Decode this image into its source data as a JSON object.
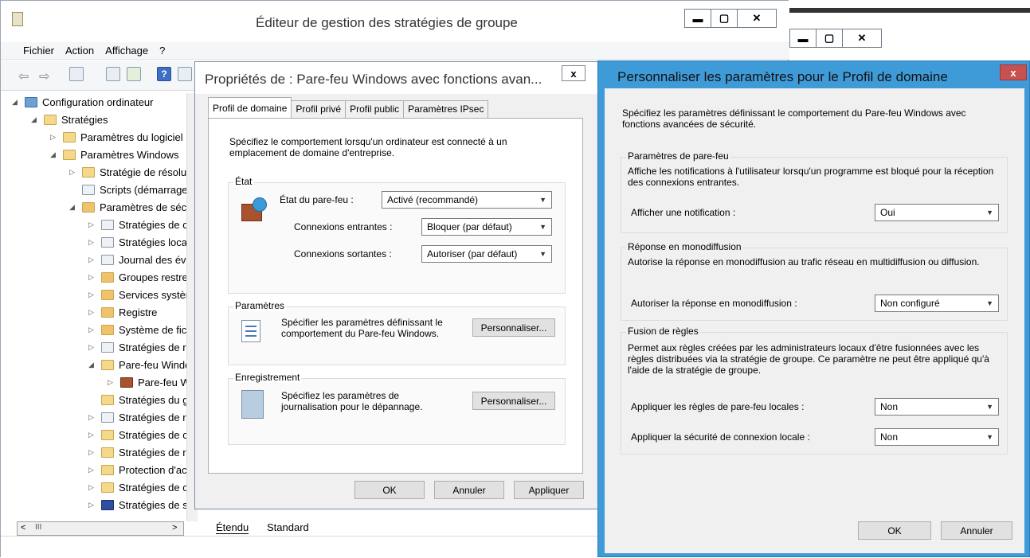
{
  "main": {
    "title": "Éditeur de gestion des stratégies de groupe",
    "menu": [
      "Fichier",
      "Action",
      "Affichage",
      "?"
    ],
    "tree": [
      {
        "label": "Configuration ordinateur",
        "level": 0,
        "exp": "◢",
        "icon": "computer"
      },
      {
        "label": "Stratégies",
        "level": 1,
        "exp": "◢",
        "icon": "folder"
      },
      {
        "label": "Paramètres du logiciel",
        "level": 2,
        "exp": "▷",
        "icon": "folder"
      },
      {
        "label": "Paramètres Windows",
        "level": 2,
        "exp": "◢",
        "icon": "folder"
      },
      {
        "label": "Stratégie de résolution de noms",
        "level": 3,
        "exp": "▷",
        "icon": "folder"
      },
      {
        "label": "Scripts (démarrage/arrêt)",
        "level": 3,
        "exp": "",
        "icon": "doc"
      },
      {
        "label": "Paramètres de sécurité",
        "level": 3,
        "exp": "◢",
        "icon": "lock"
      },
      {
        "label": "Stratégies de comptes",
        "level": 4,
        "exp": "▷",
        "icon": "doc"
      },
      {
        "label": "Stratégies locales",
        "level": 4,
        "exp": "▷",
        "icon": "doc"
      },
      {
        "label": "Journal des événements",
        "level": 4,
        "exp": "▷",
        "icon": "doc"
      },
      {
        "label": "Groupes restreints",
        "level": 4,
        "exp": "▷",
        "icon": "lock"
      },
      {
        "label": "Services système",
        "level": 4,
        "exp": "▷",
        "icon": "lock"
      },
      {
        "label": "Registre",
        "level": 4,
        "exp": "▷",
        "icon": "lock"
      },
      {
        "label": "Système de fichiers",
        "level": 4,
        "exp": "▷",
        "icon": "lock"
      },
      {
        "label": "Stratégies de réseau filaire",
        "level": 4,
        "exp": "▷",
        "icon": "doc"
      },
      {
        "label": "Pare-feu Windows",
        "level": 4,
        "exp": "◢",
        "icon": "folder"
      },
      {
        "label": "Pare-feu Windows avec fonctions",
        "level": 5,
        "exp": "▷",
        "icon": "fw"
      },
      {
        "label": "Stratégies du gestionnaire de listes",
        "level": 4,
        "exp": "",
        "icon": "folder"
      },
      {
        "label": "Stratégies de réseau sans fil",
        "level": 4,
        "exp": "▷",
        "icon": "doc"
      },
      {
        "label": "Stratégies de clé publique",
        "level": 4,
        "exp": "▷",
        "icon": "folder"
      },
      {
        "label": "Stratégies de restriction logicielle",
        "level": 4,
        "exp": "▷",
        "icon": "folder"
      },
      {
        "label": "Protection d'accès réseau",
        "level": 4,
        "exp": "▷",
        "icon": "folder"
      },
      {
        "label": "Stratégies de contrôle de l'application",
        "level": 4,
        "exp": "▷",
        "icon": "folder"
      },
      {
        "label": "Stratégies de sécurité IP",
        "level": 4,
        "exp": "▷",
        "icon": "shield"
      }
    ],
    "bottom_tabs": [
      "Étendu",
      "Standard"
    ],
    "scroll_lbl": "III"
  },
  "props": {
    "title": "Propriétés de : Pare-feu Windows avec fonctions avan...",
    "close": "x",
    "tabs": [
      "Profil de domaine",
      "Profil privé",
      "Profil public",
      "Paramètres IPsec"
    ],
    "intro": "Spécifiez le comportement lorsqu'un ordinateur  est connecté à un emplacement de domaine d'entreprise.",
    "etat": {
      "label": "État",
      "fw_label": "État du pare-feu :",
      "fw_value": "Activé (recommandé)",
      "in_label": "Connexions entrantes :",
      "in_value": "Bloquer (par défaut)",
      "out_label": "Connexions sortantes :",
      "out_value": "Autoriser (par défaut)"
    },
    "params": {
      "label": "Paramètres",
      "text": "Spécifier les paramètres définissant le comportement du Pare-feu Windows.",
      "btn": "Personnaliser..."
    },
    "log": {
      "label": "Enregistrement",
      "text": "Spécifiez les paramètres de journalisation pour le dépannage.",
      "btn": "Personnaliser..."
    },
    "ok": "OK",
    "cancel": "Annuler",
    "apply": "Appliquer"
  },
  "custom": {
    "title": "Personnaliser les paramètres pour le Profil de domaine",
    "close": "x",
    "intro": "Spécifiez les paramètres définissant le comportement du Pare-feu Windows avec fonctions avancées de sécurité.",
    "fw": {
      "label": "Paramètres de pare-feu",
      "text": "Affiche les notifications à l'utilisateur lorsqu'un programme est bloqué pour la réception des connexions entrantes.",
      "field": "Afficher une notification :",
      "value": "Oui"
    },
    "uni": {
      "label": "Réponse en monodiffusion",
      "text": "Autorise la réponse en monodiffusion au trafic réseau en multidiffusion ou diffusion.",
      "field": "Autoriser la réponse en monodiffusion :",
      "value": "Non configuré"
    },
    "merge": {
      "label": "Fusion de règles",
      "text": "Permet aux règles créées par les administrateurs locaux d'être fusionnées avec les règles distribuées via la stratégie de groupe. Ce paramètre ne peut être appliqué qu'à l'aide de la stratégie de groupe.",
      "field1": "Appliquer les règles de pare-feu locales :",
      "value1": "Non",
      "field2": "Appliquer la sécurité de connexion locale :",
      "value2": "Non"
    },
    "ok": "OK",
    "cancel": "Annuler"
  }
}
